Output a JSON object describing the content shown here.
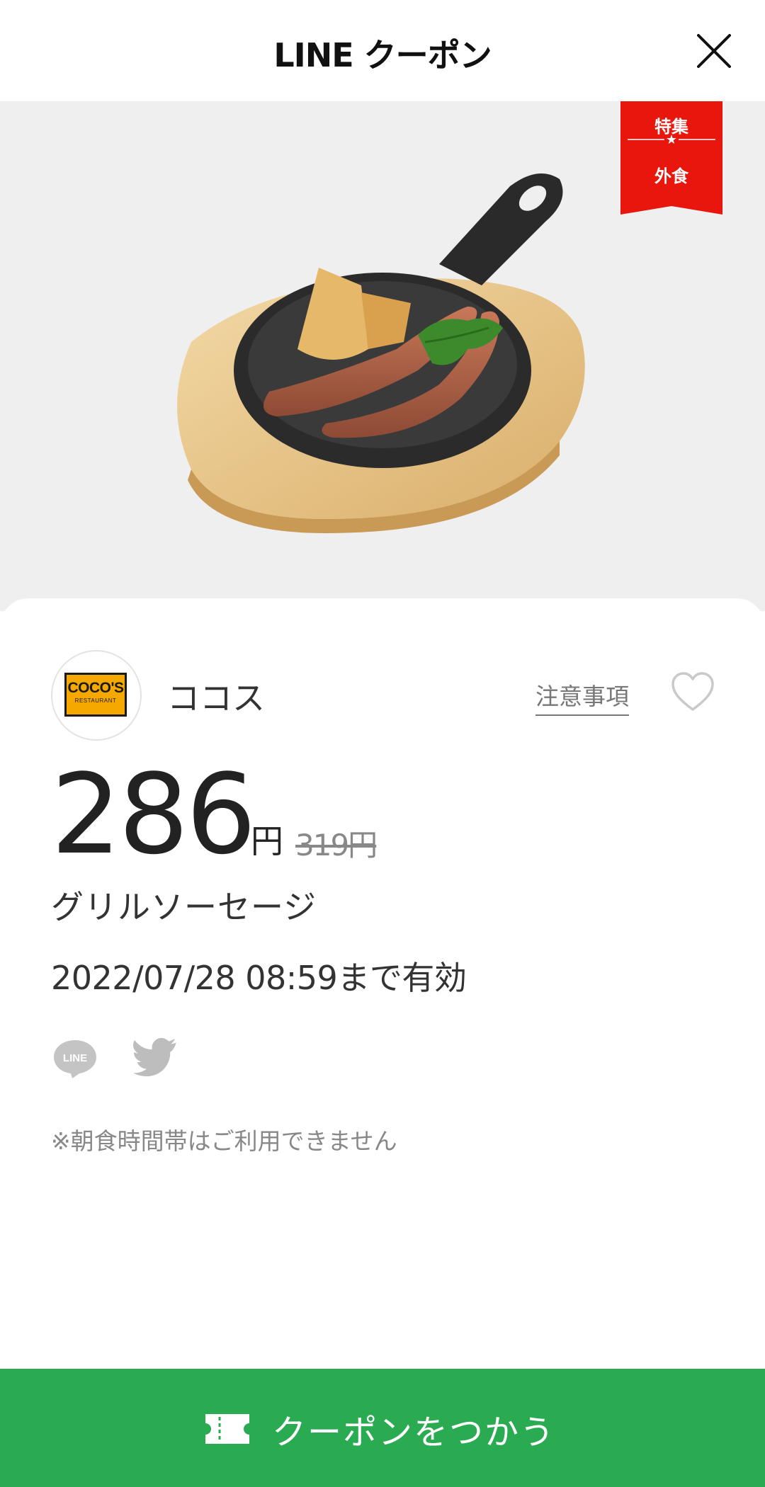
{
  "header": {
    "title": "LINE クーポン"
  },
  "badge": {
    "top": "特集",
    "bottom": "外食"
  },
  "store": {
    "logo_text": "COCO'S",
    "logo_subtext": "RESTAURANT",
    "name": "ココス",
    "notes_link": "注意事項"
  },
  "offer": {
    "price": "286",
    "price_unit": "円",
    "original_price": "319円",
    "product_name": "グリルソーセージ",
    "validity": "2022/07/28  08:59まで有効",
    "note": "※朝食時間帯はご利用できません"
  },
  "share": {
    "line_label": "LINE"
  },
  "action": {
    "use_label": "クーポンをつかう"
  },
  "colors": {
    "accent": "#2aab51",
    "badge": "#e8160c",
    "logo_orange": "#f5a800"
  },
  "icons": [
    "close-icon",
    "heart-icon",
    "line-share-icon",
    "twitter-icon",
    "ticket-icon"
  ]
}
